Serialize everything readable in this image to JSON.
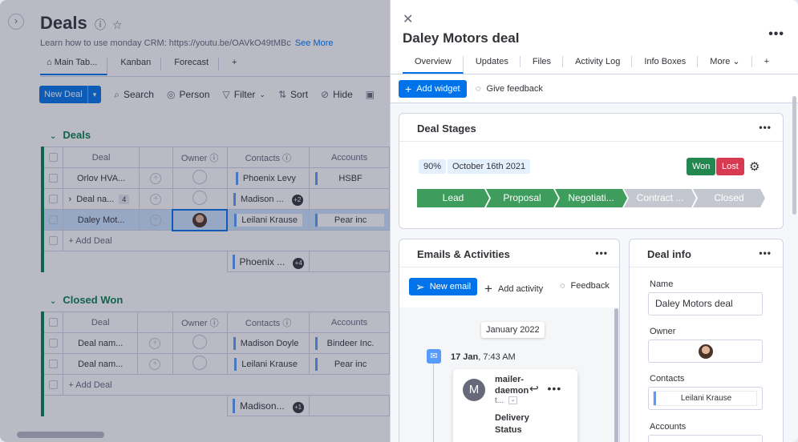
{
  "board": {
    "title": "Deals",
    "description": "Learn how to use monday CRM: https://youtu.be/OAVkO49tMBc",
    "see_more": "See More",
    "view_tabs": [
      "Main Tab...",
      "Kanban",
      "Forecast",
      "+"
    ],
    "toolbar": {
      "new_item": "New Deal",
      "search": "Search",
      "person": "Person",
      "filter": "Filter",
      "sort": "Sort",
      "hide": "Hide"
    },
    "groups": [
      {
        "title": "Deals",
        "color": "#037f4c",
        "columns": [
          "Deal",
          "Owner",
          "Contacts",
          "Accounts"
        ],
        "rows": [
          {
            "deal": "Orlov HVA...",
            "contact": "Phoenix Levy",
            "account": "HSBF"
          },
          {
            "deal": "Deal na...",
            "subitems": "4",
            "contact": "Madison ...",
            "contact_extra": "+2",
            "account": ""
          },
          {
            "deal": "Daley Mot...",
            "contact": "Leilani Krause",
            "account": "Pear inc"
          }
        ],
        "add_label": "+ Add Deal",
        "summary_contact": "Phoenix ...",
        "summary_extra": "+4"
      },
      {
        "title": "Closed Won",
        "color": "#037f4c",
        "columns": [
          "Deal",
          "Owner",
          "Contacts",
          "Accounts"
        ],
        "rows": [
          {
            "deal": "Deal nam...",
            "contact": "Madison Doyle",
            "account": "Bindeer Inc."
          },
          {
            "deal": "Deal nam...",
            "contact": "Leilani Krause",
            "account": "Pear inc"
          }
        ],
        "add_label": "+ Add Deal",
        "summary_contact": "Madison...",
        "summary_extra": "+1"
      }
    ]
  },
  "panel": {
    "title": "Daley Motors deal",
    "tabs": [
      "Overview",
      "Updates",
      "Files",
      "Activity Log",
      "Info Boxes",
      "More",
      "+"
    ],
    "add_widget": "Add widget",
    "give_feedback": "Give feedback",
    "deal_stages": {
      "title": "Deal Stages",
      "probability": "90%",
      "close_date": "October 16th 2021",
      "won_label": "Won",
      "lost_label": "Lost",
      "won_color": "#258750",
      "lost_color": "#d83a52",
      "stages": [
        {
          "label": "Lead",
          "done": true
        },
        {
          "label": "Proposal",
          "done": true
        },
        {
          "label": "Negotiati...",
          "done": true
        },
        {
          "label": "Contract ...",
          "done": false
        },
        {
          "label": "Closed",
          "done": false
        }
      ]
    },
    "emails": {
      "title": "Emails & Activities",
      "new_email": "New email",
      "add_activity": "Add activity",
      "feedback": "Feedback",
      "month": "January 2022",
      "entry_date": "17 Jan",
      "entry_time": ", 7:43 AM",
      "avatar_letter": "M",
      "from_line1": "mailer-",
      "from_line2": "daemon",
      "subject_short": "t...",
      "body_line1": "Delivery",
      "body_line2": "Status"
    },
    "deal_info": {
      "title": "Deal info",
      "name_label": "Name",
      "name_value": "Daley Motors deal",
      "owner_label": "Owner",
      "contacts_label": "Contacts",
      "contact_value": "Leilani Krause",
      "accounts_label": "Accounts"
    }
  }
}
